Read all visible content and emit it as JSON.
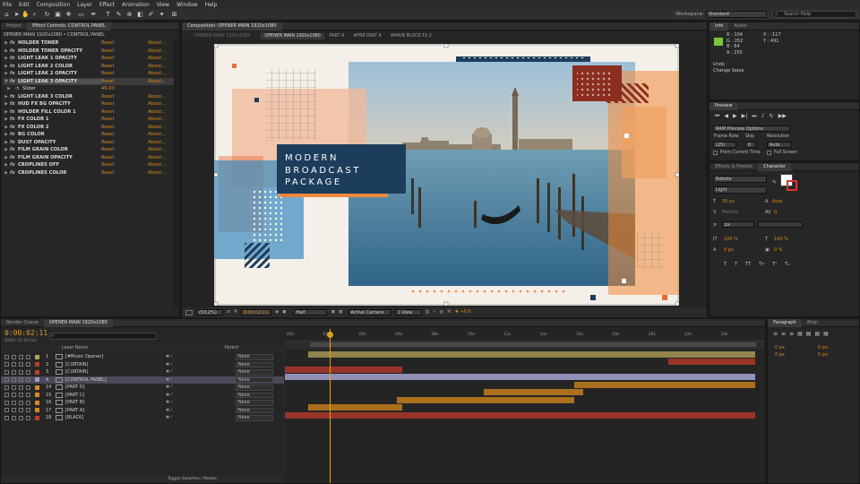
{
  "menu": [
    "File",
    "Edit",
    "Composition",
    "Layer",
    "Effect",
    "Animation",
    "View",
    "Window",
    "Help"
  ],
  "workspace": {
    "label": "Workspace:",
    "value": "Standard",
    "search_placeholder": "Search Help"
  },
  "project_tab": "Project",
  "effect_controls": {
    "tab": "Effect Controls: CONTROL PANEL",
    "header": "OPENER MAIN 1920x1080 • CONTROL PANEL",
    "reset": "Reset",
    "about": "About...",
    "rows": [
      {
        "name": "HOLDER TONER",
        "expanded": false
      },
      {
        "name": "HOLDER TONER OPACITY",
        "expanded": false
      },
      {
        "name": "LIGHT LEAK 1 OPACITY",
        "expanded": false
      },
      {
        "name": "LIGHT LEAK 2 COLOR",
        "expanded": false
      },
      {
        "name": "LIGHT LEAK 2 OPACITY",
        "expanded": false
      },
      {
        "name": "LIGHT LEAK 3 OPACITY",
        "expanded": true,
        "selected": true
      },
      {
        "name": "LIGHT LEAK 3 COLOR",
        "expanded": false
      },
      {
        "name": "HUD FX BG OPACITY",
        "expanded": false
      },
      {
        "name": "HOLDER FILL COLOR 1",
        "expanded": false
      },
      {
        "name": "FX COLOR 1",
        "expanded": false
      },
      {
        "name": "FX COLOR 2",
        "expanded": false
      },
      {
        "name": "BG COLOR",
        "expanded": false
      },
      {
        "name": "DUST OPACITY",
        "expanded": false
      },
      {
        "name": "FILM GRAIN COLOR",
        "expanded": false
      },
      {
        "name": "FILM GRAIN OPACITY",
        "expanded": false
      },
      {
        "name": "CROPLINES OFF",
        "expanded": false
      },
      {
        "name": "CROPLINES COLOR",
        "expanded": false
      }
    ],
    "slider": {
      "label": "Slider",
      "value": "46.00"
    }
  },
  "composition": {
    "tab": "Composition: OPENER MAIN 1920x1080",
    "flowchart_tab": "OPENER MAIN 1920x1080",
    "nav_tabs": [
      "OPENER MAIN 1920x1080",
      "PART A",
      "#PRE PART A",
      "#MAIN BLOCK FX 2"
    ],
    "title_lines": [
      "MODERN",
      "BROADCAST",
      "PACKAGE"
    ],
    "footer": {
      "zoom": "(53.2%)",
      "timecode": "0:00:02:11",
      "resolution": "Half",
      "camera": "Active Camera",
      "view": "1 View",
      "exposure": "+0.0"
    }
  },
  "info": {
    "tabs": [
      "Info",
      "Audio"
    ],
    "r": "R : 104",
    "g": "G : 252",
    "b": "B : 64",
    "a": "A : 255",
    "x": "X : -117",
    "y": "Y : 491",
    "undo": "Undo",
    "change": "Change Value",
    "swatch": "#7dc441"
  },
  "preview": {
    "tab": "Preview",
    "ram_options": "RAM Preview Options",
    "frame_rate_label": "Frame Rate",
    "skip_label": "Skip",
    "resolution_label": "Resolution",
    "frame_rate": "(25)",
    "skip": "0",
    "resolution": "Auto",
    "from_current": "From Current Time",
    "full_screen": "Full Screen"
  },
  "character": {
    "tabs": [
      "Effects & Presets",
      "Character"
    ],
    "font": "Roboto",
    "style": "Light",
    "size": "35 px",
    "leading": "Auto",
    "kerning": "Metrics",
    "tracking": "0",
    "stroke": "px",
    "vscale": "100 %",
    "hscale": "100 %",
    "baseline": "0 px",
    "tsume": "0 %"
  },
  "paragraph": {
    "tabs": [
      "Paragraph",
      "Align"
    ],
    "indent_values": [
      "0 px",
      "0 px",
      "0 px",
      "0 px",
      "0 px"
    ]
  },
  "timeline": {
    "tabs": [
      "Render Queue",
      "OPENER MAIN 1920x1080"
    ],
    "timecode": "0:00:02:11",
    "subtime": "00061 (25.00 fps)",
    "search_placeholder": "",
    "col_layer": "Layer Name",
    "col_parent": "Parent",
    "toggle": "Toggle Switches / Modes",
    "ruler": [
      "00s",
      "02s",
      "04s",
      "06s",
      "08s",
      "10s",
      "12s",
      "14s",
      "16s",
      "18s",
      "20s",
      "22s",
      "24s"
    ],
    "layers": [
      {
        "num": "1",
        "name": "[#Music Opener]",
        "label": "#b7a45a",
        "parent": "None"
      },
      {
        "num": "2",
        "name": "[CURTAIN]",
        "label": "#c0392b",
        "parent": "None"
      },
      {
        "num": "3",
        "name": "[CURTAIN]",
        "label": "#c0392b",
        "parent": "None"
      },
      {
        "num": "4",
        "name": "[CONTROL PANEL]",
        "label": "#9c9cc9",
        "parent": "None",
        "selected": true
      },
      {
        "num": "14",
        "name": "[PART D]",
        "label": "#d88a1c",
        "parent": "None"
      },
      {
        "num": "15",
        "name": "[PART C]",
        "label": "#d88a1c",
        "parent": "None"
      },
      {
        "num": "16",
        "name": "[PART B]",
        "label": "#d88a1c",
        "parent": "None"
      },
      {
        "num": "17",
        "name": "[PART A]",
        "label": "#d88a1c",
        "parent": "None"
      },
      {
        "num": "18",
        "name": "[BLACK]",
        "label": "#c0392b",
        "parent": "None"
      }
    ]
  },
  "colors": {
    "accent_orange": "#d98a20",
    "timeline_cti": "#e0a020",
    "brand_navy": "#1d3d5c",
    "brand_orange": "#f28a3c"
  }
}
